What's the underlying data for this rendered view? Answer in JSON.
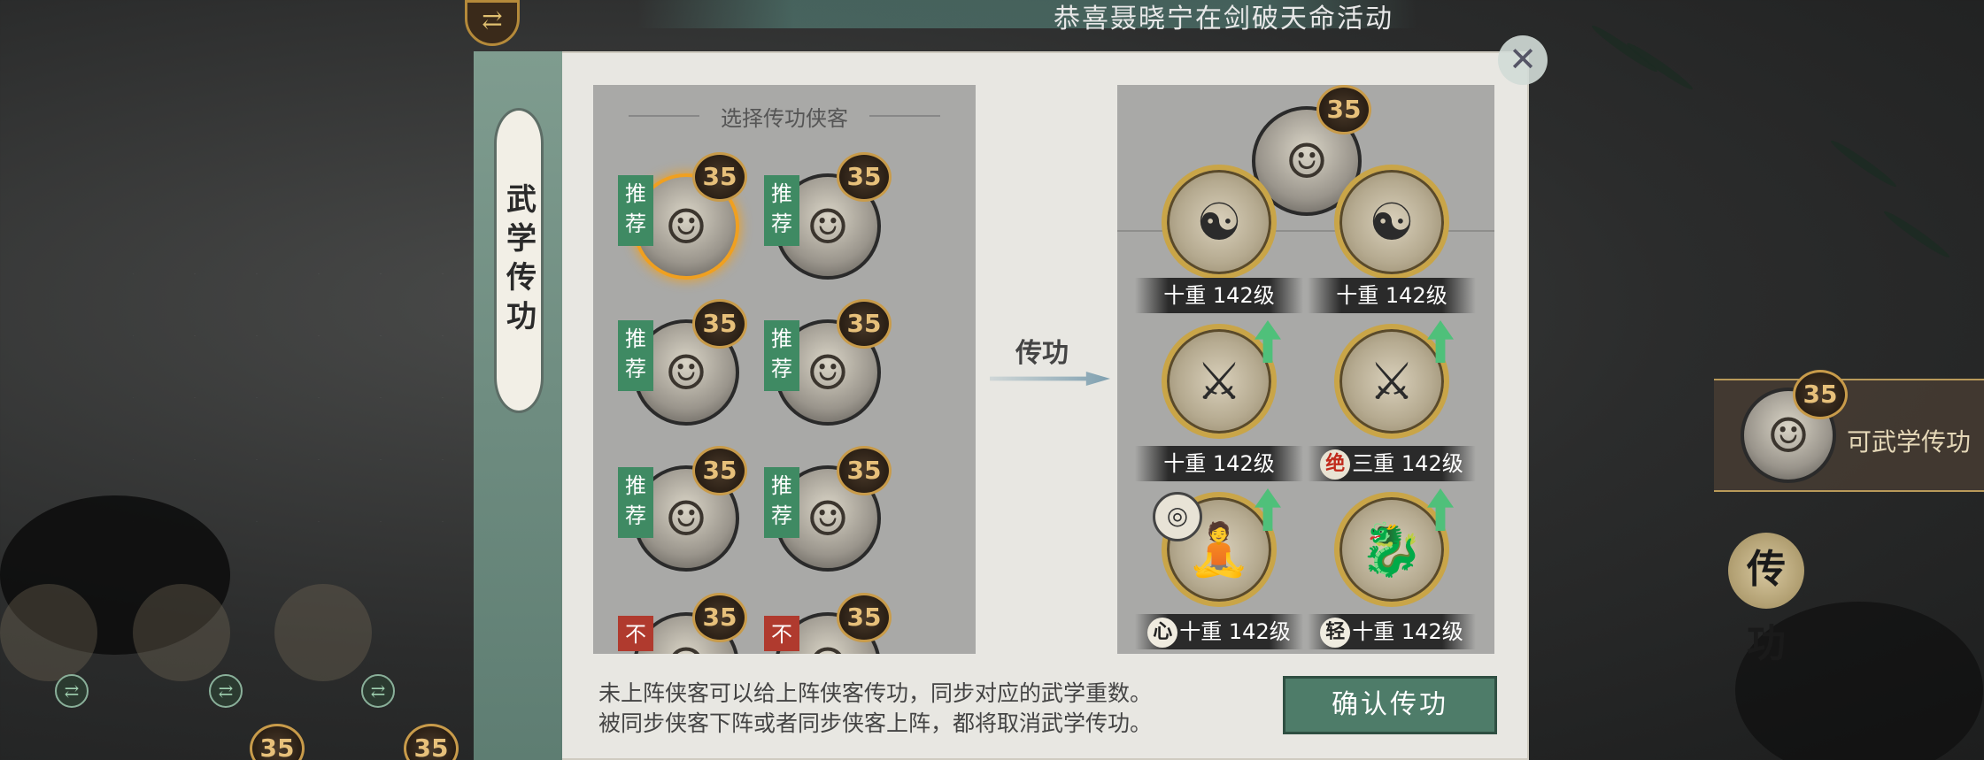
{
  "top_banner": {
    "text": "恭喜聂晓宁在剑破天命活动"
  },
  "side_tab": {
    "label": "武学传功"
  },
  "candidate_panel": {
    "title": "选择传功侠客",
    "candidates": [
      {
        "level": "35",
        "tag": "推荐",
        "selected": true,
        "avatar": "female-hero-purple-headband"
      },
      {
        "level": "35",
        "tag": "推荐",
        "selected": false,
        "avatar": "male-hero-hat"
      },
      {
        "level": "35",
        "tag": "推荐",
        "selected": false,
        "avatar": "bald-monk"
      },
      {
        "level": "35",
        "tag": "推荐",
        "selected": false,
        "avatar": "female-hero-hair-bun"
      },
      {
        "level": "35",
        "tag": "推荐",
        "selected": false,
        "avatar": "female-hero-flower"
      },
      {
        "level": "35",
        "tag": "推荐",
        "selected": false,
        "avatar": "female-hero-blue-robe"
      },
      {
        "level": "35",
        "tag": "不",
        "selected": false,
        "avatar": "hero-partial"
      },
      {
        "level": "35",
        "tag": "不",
        "selected": false,
        "avatar": "hero-partial-2"
      }
    ]
  },
  "transfer_label": "传功",
  "target": {
    "level": "35",
    "avatar": "male-hero-long-hair"
  },
  "skills": [
    {
      "prefix": "",
      "level_text": "十重 142级",
      "upgrade": false
    },
    {
      "prefix": "",
      "level_text": "十重 142级",
      "upgrade": false
    },
    {
      "prefix": "",
      "level_text": "十重 142级",
      "upgrade": true
    },
    {
      "prefix": "绝",
      "level_text": "三重 142级",
      "upgrade": true
    },
    {
      "prefix": "心",
      "level_text": "十重 142级",
      "upgrade": true
    },
    {
      "prefix": "轻",
      "level_text": "十重 142级",
      "upgrade": true
    }
  ],
  "info_lines": [
    "未上阵侠客可以给上阵侠客传功，同步对应的武学重数。",
    "被同步侠客下阵或者同步侠客上阵，都将取消武学传功。"
  ],
  "confirm_button": "确认传功",
  "side_card": {
    "level": "35",
    "text": "可武学传功"
  },
  "side_transfer_icon": "传功",
  "bottom_levels": [
    "35",
    "35"
  ],
  "colors": {
    "recommend_tag": "#3f8a63",
    "not_tag": "#b03a2e",
    "confirm_button": "#4e7c69",
    "upgrade_arrow": "#4fc07a",
    "level_badge_border": "#c89b4a"
  }
}
